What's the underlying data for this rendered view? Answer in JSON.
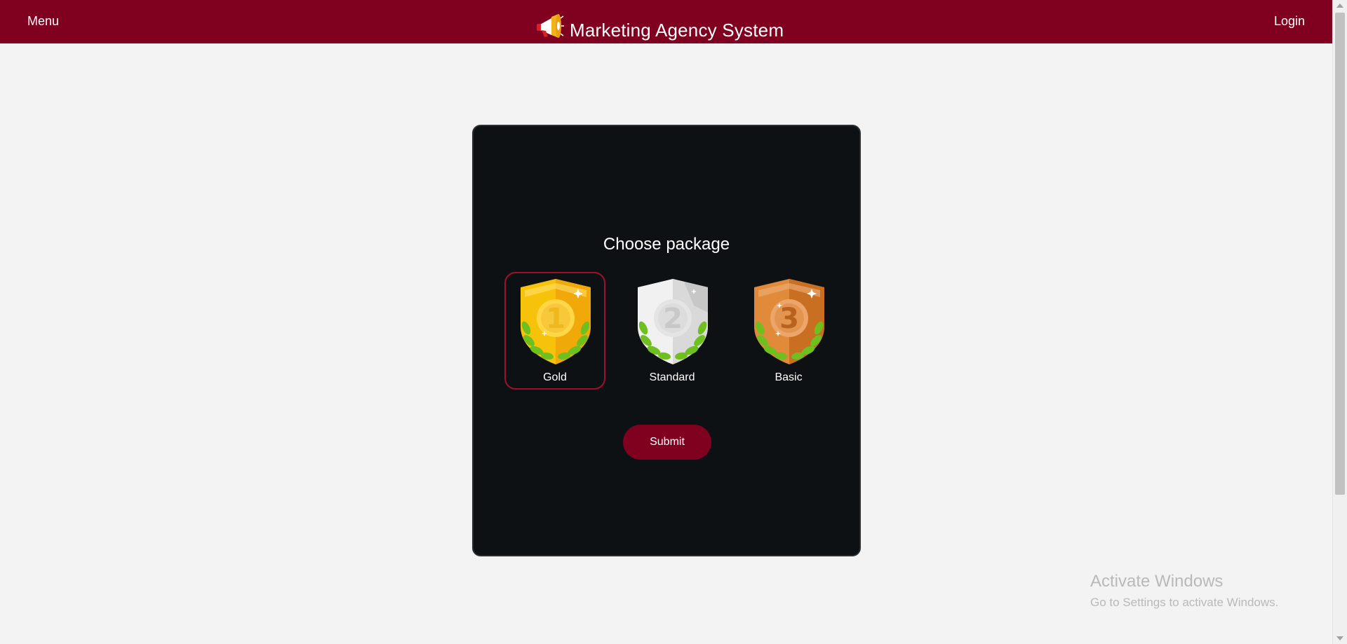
{
  "navbar": {
    "menu_label": "Menu",
    "title": "Marketing Agency System",
    "login_label": "Login",
    "logo_icon": "megaphone-icon"
  },
  "card": {
    "title": "Choose package",
    "packages": [
      {
        "label": "Gold",
        "rank": "1",
        "icon": "gold-medal-shield-icon",
        "selected": true
      },
      {
        "label": "Standard",
        "rank": "2",
        "icon": "silver-medal-shield-icon",
        "selected": false
      },
      {
        "label": "Basic",
        "rank": "3",
        "icon": "bronze-medal-shield-icon",
        "selected": false
      }
    ],
    "submit_label": "Submit"
  },
  "watermark": {
    "title": "Activate Windows",
    "subtitle": "Go to Settings to activate Windows."
  },
  "colors": {
    "brand": "#800020",
    "card_bg": "#0e1113",
    "page_bg": "#f3f3f3",
    "selected_border": "#a0102d"
  }
}
